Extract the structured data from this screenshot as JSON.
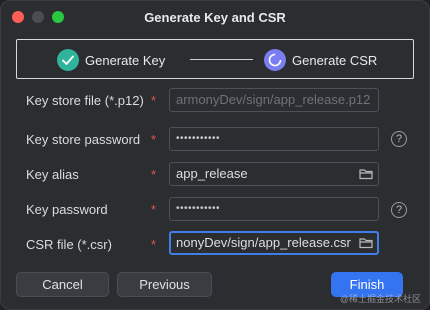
{
  "window": {
    "title": "Generate Key and CSR"
  },
  "steps": [
    {
      "label": "Generate Key",
      "state": "done",
      "icon": "check-icon",
      "color": "#2fb39a"
    },
    {
      "label": "Generate CSR",
      "state": "current",
      "icon": "refresh-icon",
      "color": "#7b7ef0"
    }
  ],
  "form": {
    "required_mark": "*",
    "keystore_file": {
      "label": "Key store file (*.p12)",
      "value": "armonyDev/sign/app_release.p12"
    },
    "keystore_password": {
      "label": "Key store password",
      "value": "•••••••••••"
    },
    "key_alias": {
      "label": "Key alias",
      "value": "app_release"
    },
    "key_password": {
      "label": "Key password",
      "value": "•••••••••••"
    },
    "csr_file": {
      "label": "CSR file (*.csr)",
      "value": "nonyDev/sign/app_release.csr"
    }
  },
  "help_icon": "?",
  "buttons": {
    "cancel": "Cancel",
    "previous": "Previous",
    "finish": "Finish"
  },
  "watermark": "@稀土掘金技术社区",
  "colors": {
    "accent": "#3574f0",
    "required": "#e2564c"
  }
}
